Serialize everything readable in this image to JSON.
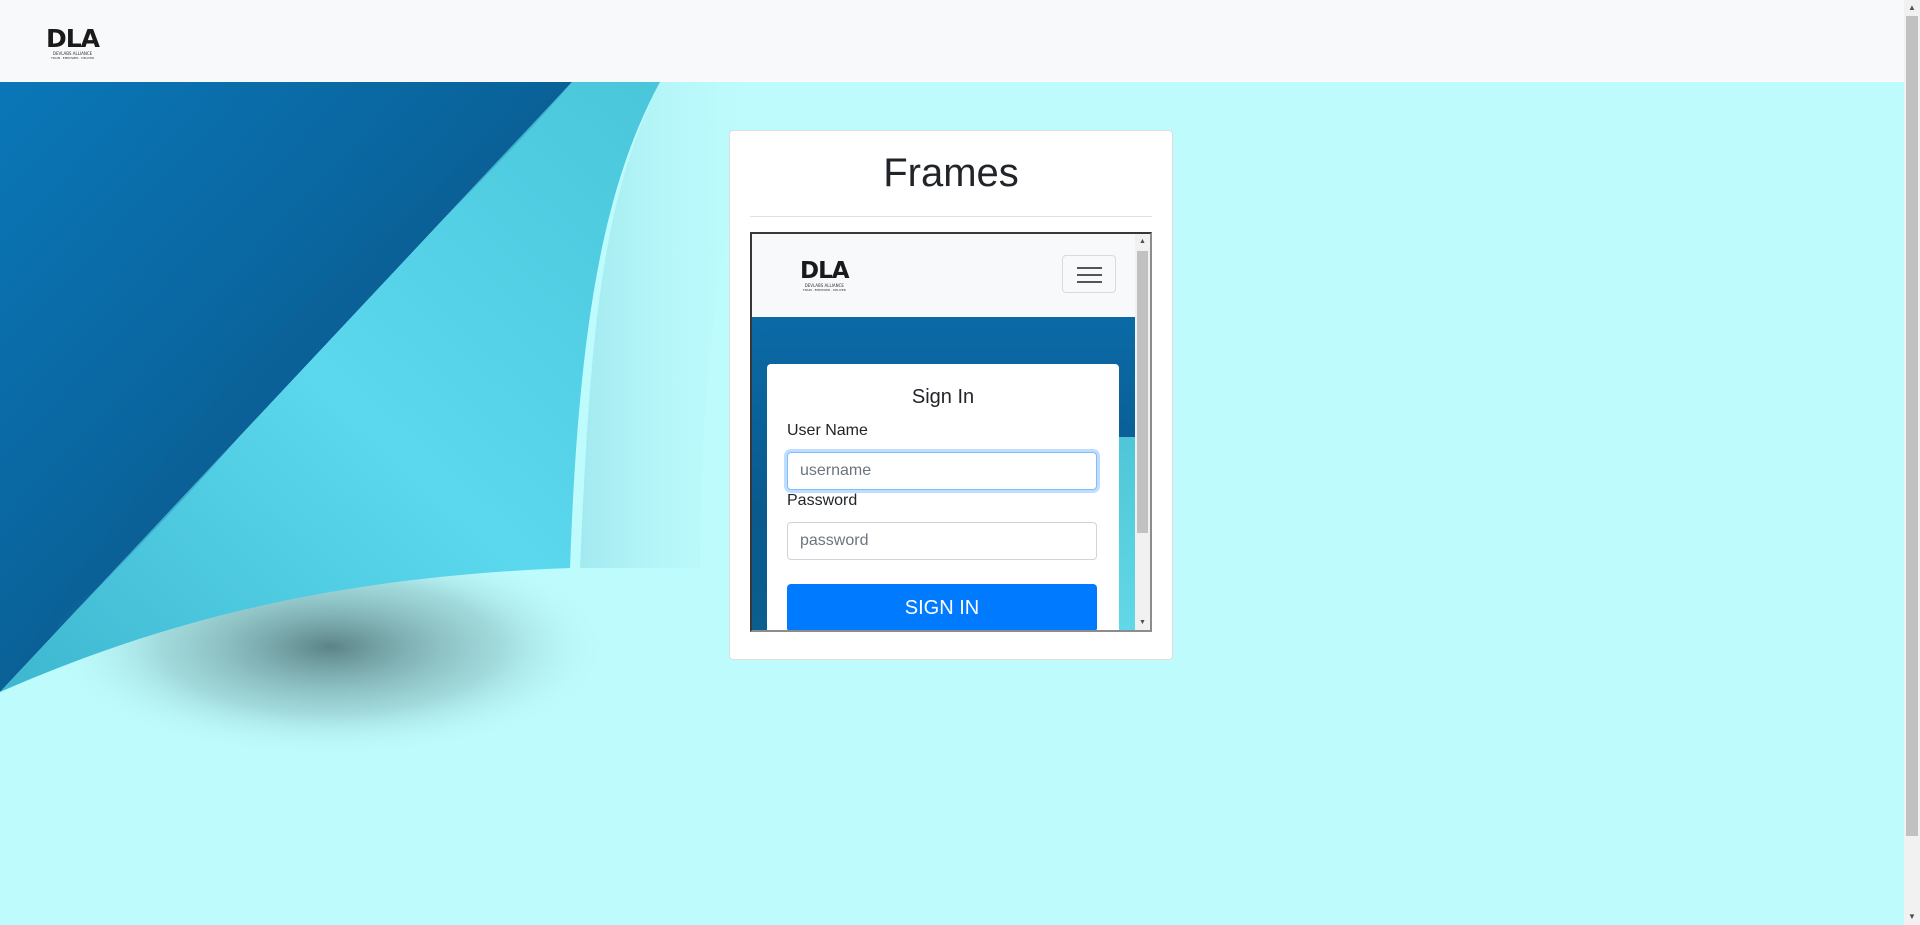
{
  "navbar": {
    "logo": {
      "mark": "DLA",
      "line1": "DEVLABS ALLIANCE",
      "line2": "TRAIN · EMPOWER · DELIVER"
    }
  },
  "card": {
    "title": "Frames"
  },
  "iframe": {
    "logo": {
      "mark": "DLA",
      "line1": "DEVLABS ALLIANCE",
      "line2": "TRAIN · EMPOWER · DELIVER"
    },
    "signin": {
      "title": "Sign In",
      "username_label": "User Name",
      "username_placeholder": "username",
      "username_value": "",
      "password_label": "Password",
      "password_placeholder": "password",
      "password_value": "",
      "button_label": "SIGN IN"
    }
  },
  "colors": {
    "page_background": "#bdfbfc",
    "navbar": "#f8f9fa",
    "primary_button": "#007bff",
    "hero_dark_blue": "#0a5a8e",
    "curl_cyan": "#5cdcef"
  },
  "icons": {
    "hamburger": "menu-icon",
    "scroll_up": "scroll-up-arrow-icon",
    "scroll_down": "scroll-down-arrow-icon"
  }
}
